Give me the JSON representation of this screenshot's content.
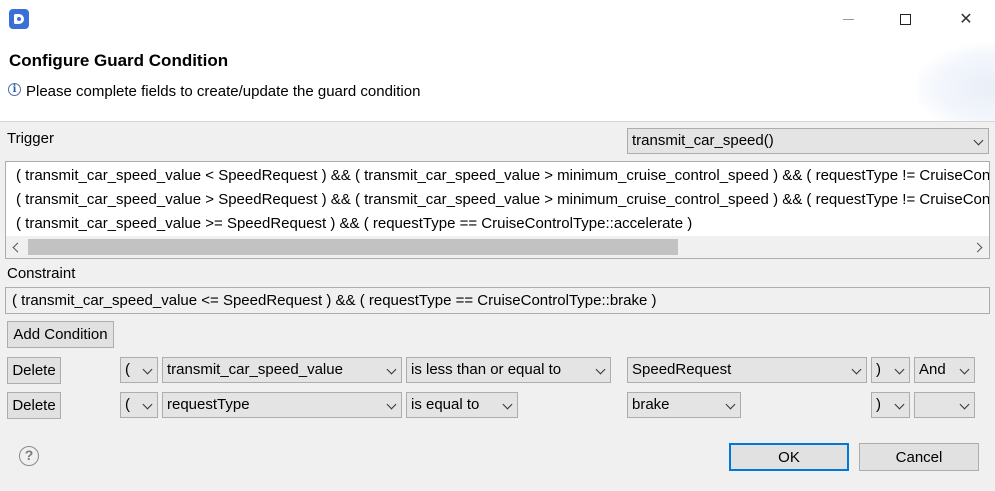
{
  "window": {
    "title": "Configure Guard Condition",
    "message": "Please complete fields to create/update the guard condition",
    "app_icon": "d-app-icon",
    "controls": {
      "minimize": "minimize-icon",
      "maximize": "maximize-icon",
      "close": "✕"
    }
  },
  "trigger": {
    "label": "Trigger",
    "selected": "transmit_car_speed()",
    "lines": [
      "( transmit_car_speed_value < SpeedRequest ) && ( transmit_car_speed_value > minimum_cruise_control_speed ) && ( requestType != CruiseControlType::brake )",
      "( transmit_car_speed_value > SpeedRequest ) && ( transmit_car_speed_value > minimum_cruise_control_speed ) && ( requestType != CruiseControlType::brake )",
      "( transmit_car_speed_value >= SpeedRequest ) && ( requestType == CruiseControlType::accelerate )"
    ]
  },
  "constraint": {
    "label": "Constraint",
    "value": "( transmit_car_speed_value <= SpeedRequest ) && ( requestType == CruiseControlType::brake )"
  },
  "add_condition_label": "Add Condition",
  "conditions": [
    {
      "delete_label": "Delete",
      "open_paren": "(",
      "variable": "transmit_car_speed_value",
      "operator": "is less than or equal to",
      "value": "SpeedRequest",
      "close_paren": ")",
      "logic": "And"
    },
    {
      "delete_label": "Delete",
      "open_paren": "(",
      "variable": "requestType",
      "operator": "is equal to",
      "value": "brake",
      "close_paren": ")",
      "logic": ""
    }
  ],
  "footer": {
    "ok_label": "OK",
    "cancel_label": "Cancel",
    "help_symbol": "?"
  }
}
